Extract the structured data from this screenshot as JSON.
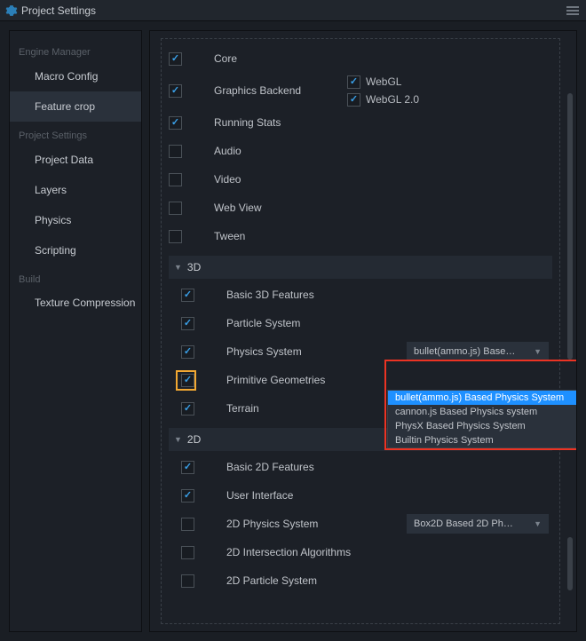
{
  "titlebar": {
    "title": "Project Settings"
  },
  "sidebar": {
    "groups": [
      {
        "label": "Engine Manager",
        "items": [
          {
            "label": "Macro Config",
            "active": false
          },
          {
            "label": "Feature crop",
            "active": true
          }
        ]
      },
      {
        "label": "Project Settings",
        "items": [
          {
            "label": "Project Data"
          },
          {
            "label": "Layers"
          },
          {
            "label": "Physics"
          },
          {
            "label": "Scripting"
          }
        ]
      },
      {
        "label": "Build",
        "items": [
          {
            "label": "Texture Compression"
          }
        ]
      }
    ]
  },
  "features": {
    "top": [
      {
        "label": "Core",
        "checked": true
      },
      {
        "label": "Graphics Backend",
        "checked": true,
        "subs": [
          {
            "label": "WebGL",
            "checked": true
          },
          {
            "label": "WebGL 2.0",
            "checked": true
          }
        ]
      },
      {
        "label": "Running Stats",
        "checked": true
      },
      {
        "label": "Audio",
        "checked": false
      },
      {
        "label": "Video",
        "checked": false
      },
      {
        "label": "Web View",
        "checked": false
      },
      {
        "label": "Tween",
        "checked": false
      }
    ],
    "section3d": {
      "title": "3D",
      "items": [
        {
          "label": "Basic 3D Features",
          "checked": true
        },
        {
          "label": "Particle System",
          "checked": true
        },
        {
          "label": "Physics System",
          "checked": true,
          "select": "bullet(ammo.js) Base…"
        },
        {
          "label": "Primitive Geometries",
          "checked": true
        },
        {
          "label": "Terrain",
          "checked": true
        }
      ]
    },
    "section2d": {
      "title": "2D",
      "items": [
        {
          "label": "Basic 2D Features",
          "checked": true
        },
        {
          "label": "User Interface",
          "checked": true
        },
        {
          "label": "2D Physics System",
          "checked": false,
          "select": "Box2D Based 2D Ph…"
        },
        {
          "label": "2D Intersection Algorithms",
          "checked": false
        },
        {
          "label": "2D Particle System",
          "checked": false
        }
      ]
    }
  },
  "dropdown": {
    "options": [
      {
        "label": "bullet(ammo.js) Based Physics System",
        "selected": true
      },
      {
        "label": "cannon.js Based Physics system",
        "selected": false
      },
      {
        "label": "PhysX Based Physics System",
        "selected": false
      },
      {
        "label": "Builtin Physics System",
        "selected": false
      }
    ]
  }
}
